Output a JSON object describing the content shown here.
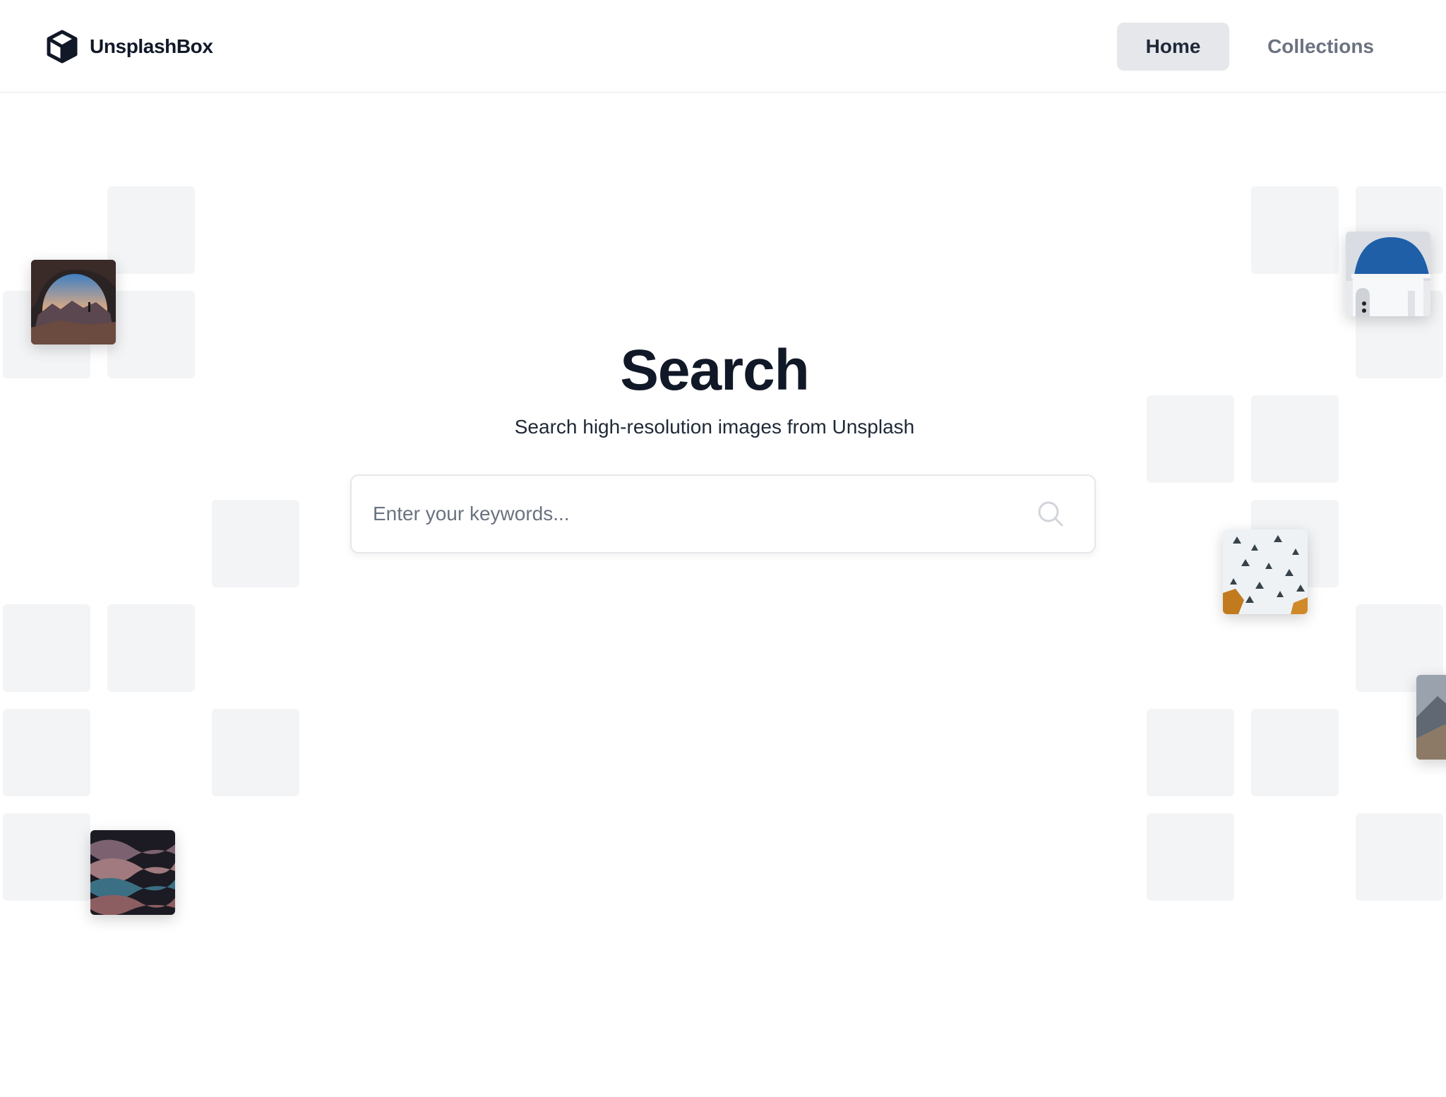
{
  "app": {
    "brand_name": "UnsplashBox",
    "logo_icon": "cube-icon"
  },
  "nav": {
    "items": [
      {
        "label": "Home",
        "active": true
      },
      {
        "label": "Collections",
        "active": false
      }
    ]
  },
  "hero": {
    "title": "Search",
    "subtitle": "Search high-resolution images from Unsplash"
  },
  "search": {
    "placeholder": "Enter your keywords...",
    "value": "",
    "icon": "search-icon"
  },
  "colors": {
    "text_primary": "#111827",
    "nav_active_bg": "#e5e7eb",
    "tile_bg": "#f3f4f6",
    "border": "#e5e7eb"
  }
}
